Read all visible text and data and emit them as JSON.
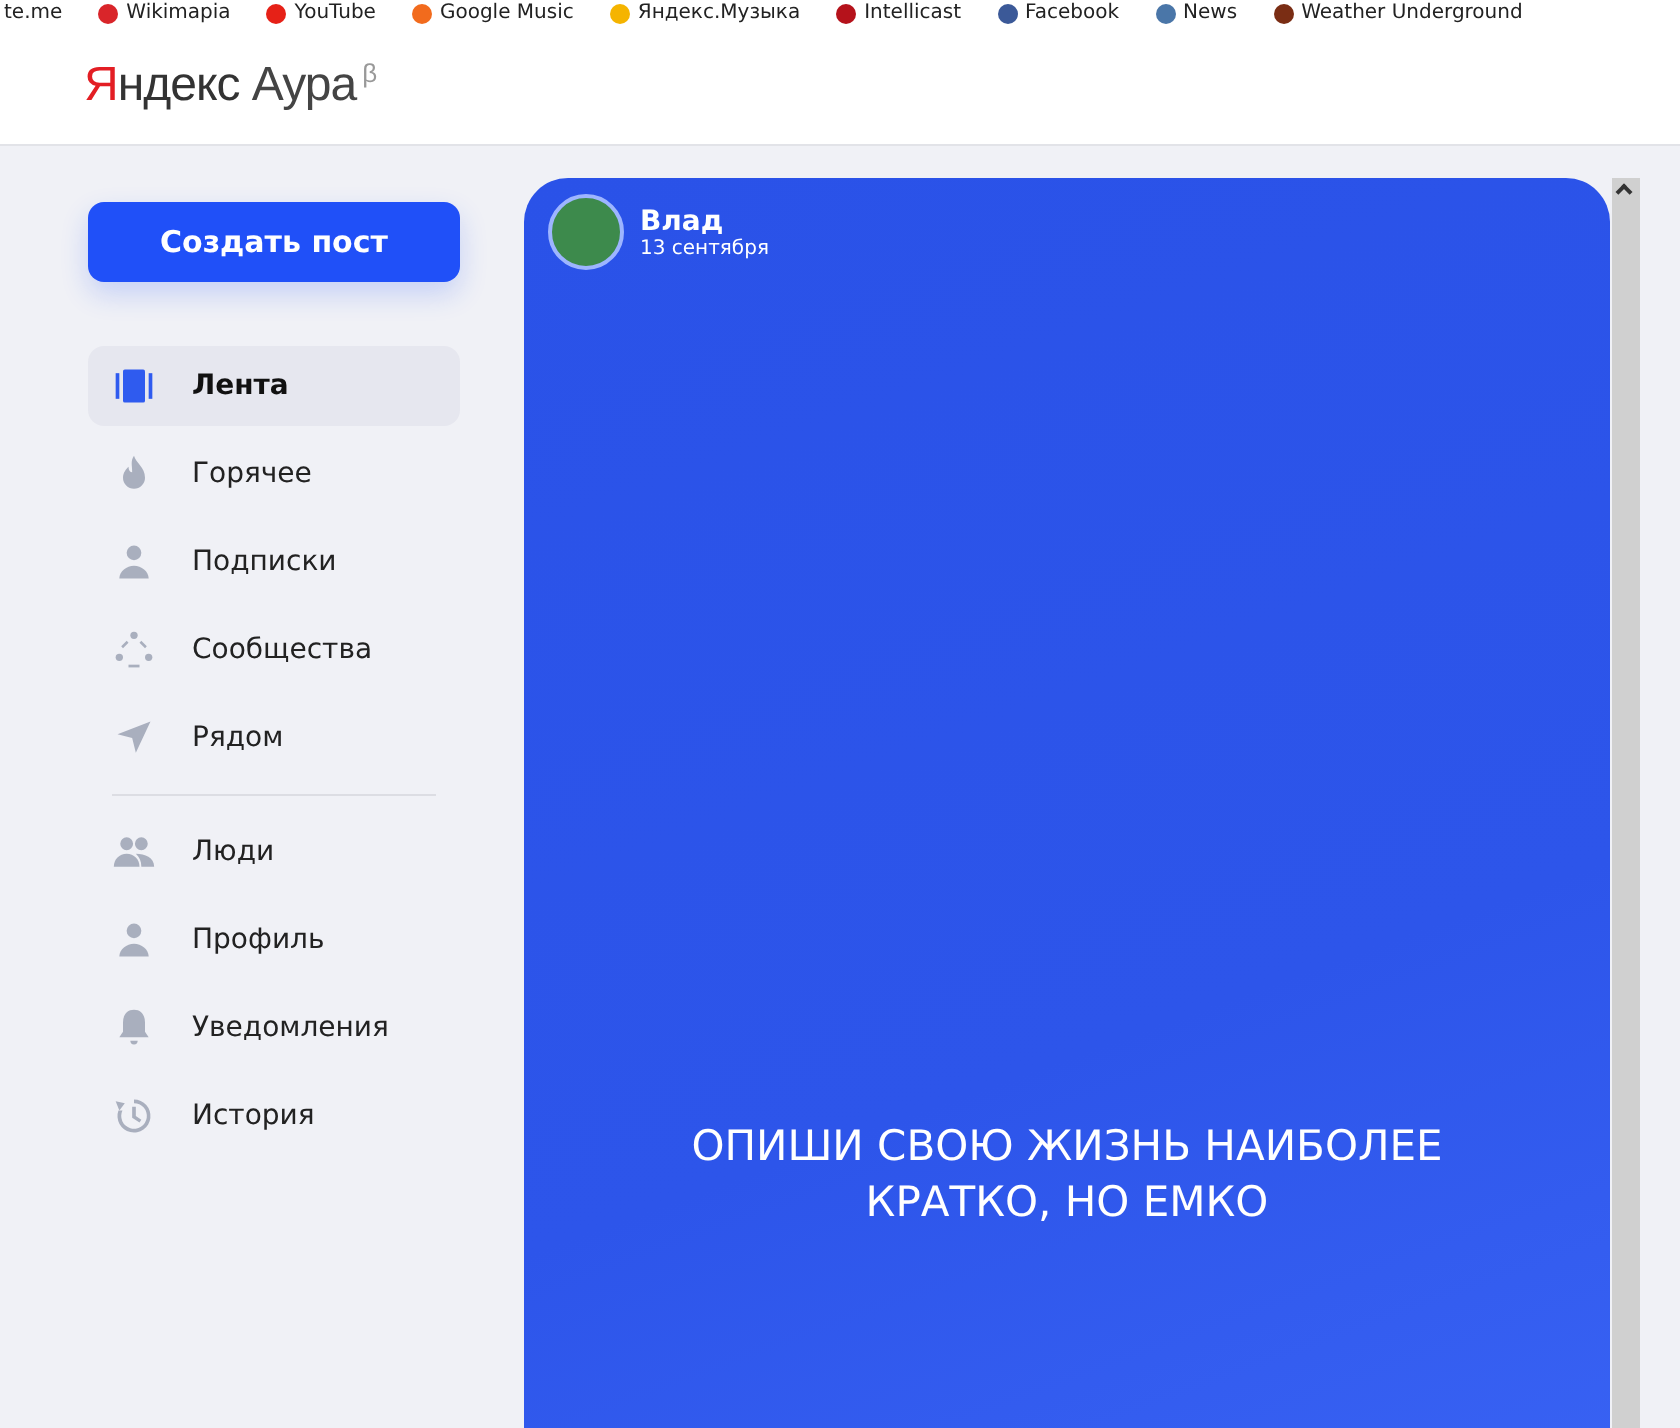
{
  "bookmarks": [
    {
      "label": "te.me",
      "kind": "plain"
    },
    {
      "label": "Wikimapia",
      "kind": "wikimapia"
    },
    {
      "label": "YouTube",
      "kind": "youtube"
    },
    {
      "label": "Google Music",
      "kind": "music"
    },
    {
      "label": "Яндекс.Музыка",
      "kind": "yamusic"
    },
    {
      "label": "Intellicast",
      "kind": "intellicast"
    },
    {
      "label": "Facebook",
      "kind": "facebook"
    },
    {
      "label": "News",
      "kind": "news"
    },
    {
      "label": "Weather Underground",
      "kind": "weather"
    }
  ],
  "logo": {
    "brand_first": "Я",
    "brand_rest": "ндекс",
    "product": "Аура",
    "badge": "β"
  },
  "create_button": "Создать пост",
  "nav": [
    {
      "label": "Лента",
      "kind": "feed",
      "selected": true
    },
    {
      "label": "Горячее",
      "kind": "fire",
      "selected": false
    },
    {
      "label": "Подписки",
      "kind": "person",
      "selected": false
    },
    {
      "label": "Сообщества",
      "kind": "community",
      "selected": false
    },
    {
      "label": "Рядом",
      "kind": "nearby",
      "selected": false
    }
  ],
  "nav_secondary": [
    {
      "label": "Люди",
      "kind": "people",
      "selected": false
    },
    {
      "label": "Профиль",
      "kind": "person",
      "selected": false
    },
    {
      "label": "Уведомления",
      "kind": "bell",
      "selected": false
    },
    {
      "label": "История",
      "kind": "history",
      "selected": false
    }
  ],
  "post": {
    "author": "Влад",
    "date": "13 сентября",
    "text": "ОПИШИ СВОЮ ЖИЗНЬ НАИБОЛЕЕ КРАТКО, НО ЕМКО"
  }
}
